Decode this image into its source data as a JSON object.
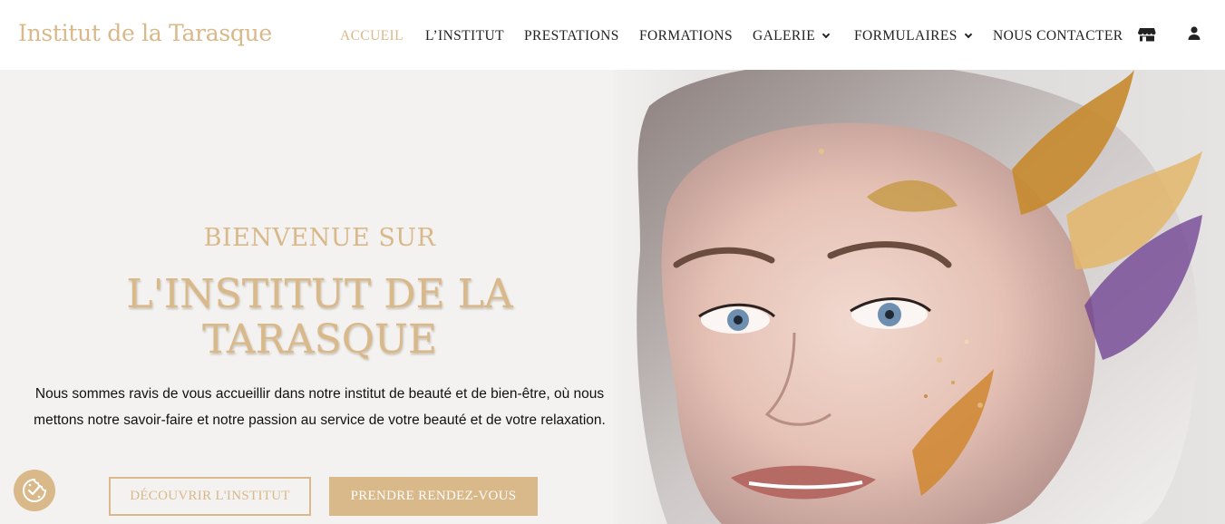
{
  "header": {
    "logo": "Institut de la Tarasque",
    "nav": [
      {
        "label": "ACCUEIL",
        "active": true
      },
      {
        "label": "L’INSTITUT"
      },
      {
        "label": "PRESTATIONS"
      },
      {
        "label": "FORMATIONS"
      },
      {
        "label": "GALERIE",
        "dropdown": true
      },
      {
        "label": "FORMULAIRES",
        "dropdown": true
      },
      {
        "label": "NOUS CONTACTER"
      }
    ],
    "icons": [
      "shop-icon",
      "user-icon"
    ]
  },
  "hero": {
    "kicker": "BIENVENUE SUR",
    "headline_line1": "L'INSTITUT DE LA",
    "headline_line2": "TARASQUE",
    "intro_line1": "Nous sommes ravis de vous accueillir dans notre institut de beauté et de bien-être, où nous",
    "intro_line2": "mettons notre savoir-faire et notre passion au service de votre beauté et de votre relaxation.",
    "button_discover": "DÉCOUVRIR L'INSTITUT",
    "button_appointment": "PRENDRE RENDEZ-VOUS"
  },
  "colors": {
    "accent": "#d9b889",
    "text": "#222222",
    "hero_bg": "#f3f2f0"
  },
  "cookie": {
    "icon": "cookie-consent-icon"
  }
}
